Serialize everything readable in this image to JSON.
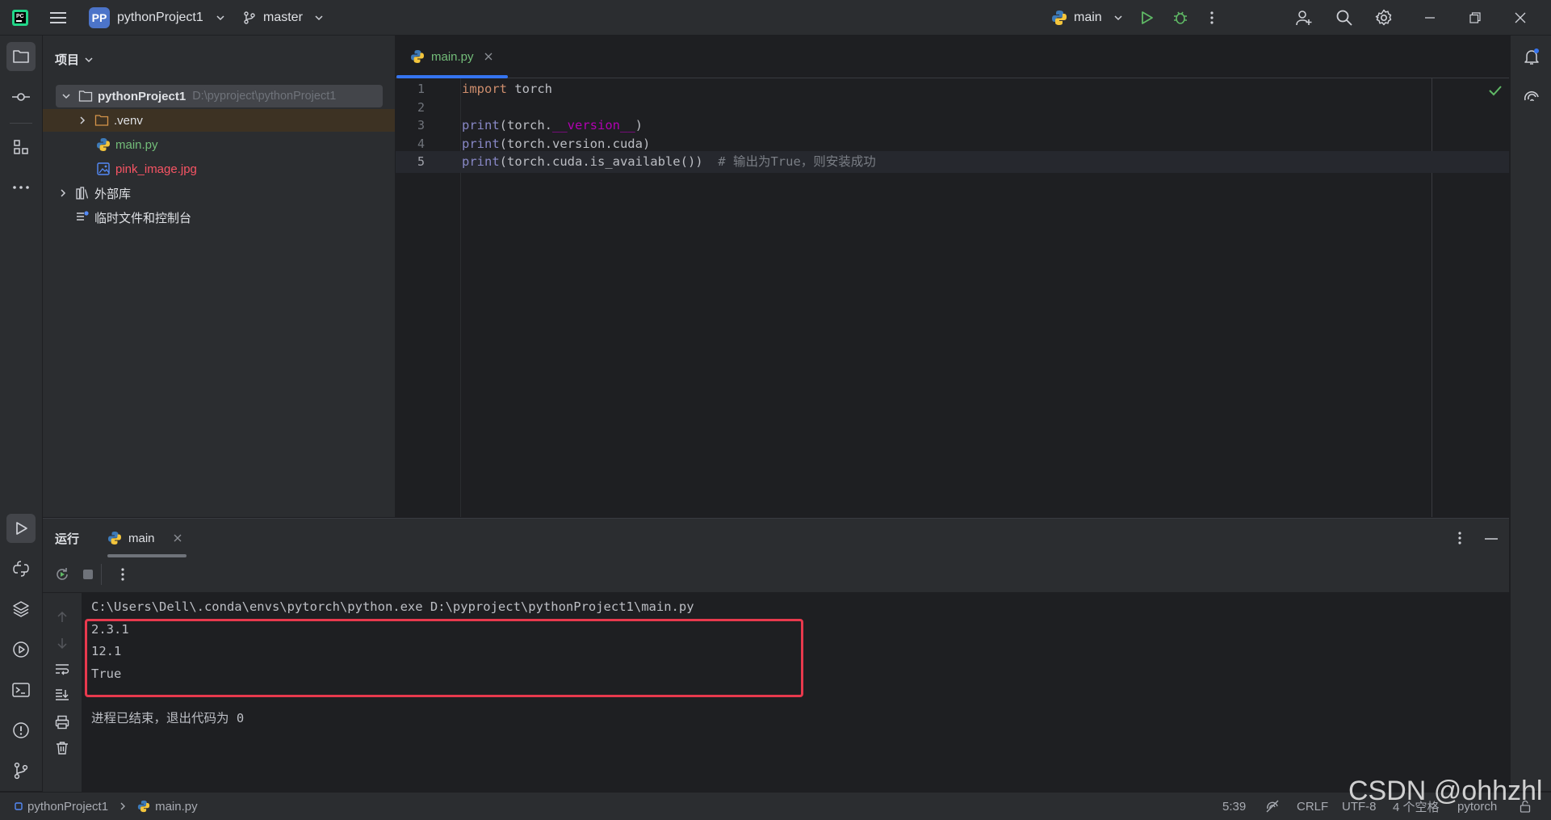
{
  "titlebar": {
    "project_badge": "PP",
    "project_name": "pythonProject1",
    "branch": "master",
    "run_config": "main"
  },
  "project_panel": {
    "title": "项目",
    "root_name": "pythonProject1",
    "root_path": "D:\\pyproject\\pythonProject1",
    "items": [
      {
        "label": ".venv"
      },
      {
        "label": "main.py"
      },
      {
        "label": "pink_image.jpg"
      },
      {
        "label": "外部库"
      },
      {
        "label": "临时文件和控制台"
      }
    ]
  },
  "editor": {
    "tab_label": "main.py",
    "line_numbers": [
      "1",
      "2",
      "3",
      "4",
      "5"
    ],
    "line1": {
      "kw": "import",
      "rest": " torch"
    },
    "line3": {
      "fn": "print",
      "a": "(torch.",
      "magic": "__version__",
      "b": ")"
    },
    "line4": {
      "fn": "print",
      "a": "(torch.version.cuda)"
    },
    "line5": {
      "fn": "print",
      "a": "(torch.cuda.is_available())",
      "comment": "  # 输出为True，则安装成功"
    }
  },
  "run_panel": {
    "title": "运行",
    "tab_label": "main",
    "console_lines": [
      "C:\\Users\\Dell\\.conda\\envs\\pytorch\\python.exe D:\\pyproject\\pythonProject1\\main.py",
      "2.3.1",
      "12.1",
      "True",
      "",
      "进程已结束，退出代码为 0"
    ]
  },
  "statusbar": {
    "breadcrumb_project": "pythonProject1",
    "breadcrumb_file": "main.py",
    "position": "5:39",
    "line_separator": "CRLF",
    "encoding": "UTF-8",
    "indent": "4 个空格",
    "interpreter": "pytorch"
  },
  "watermark": "CSDN @ohhzhl",
  "colors": {
    "accent": "#3574f0",
    "highlight_box": "#e8394d",
    "run_green": "#5fb865"
  }
}
